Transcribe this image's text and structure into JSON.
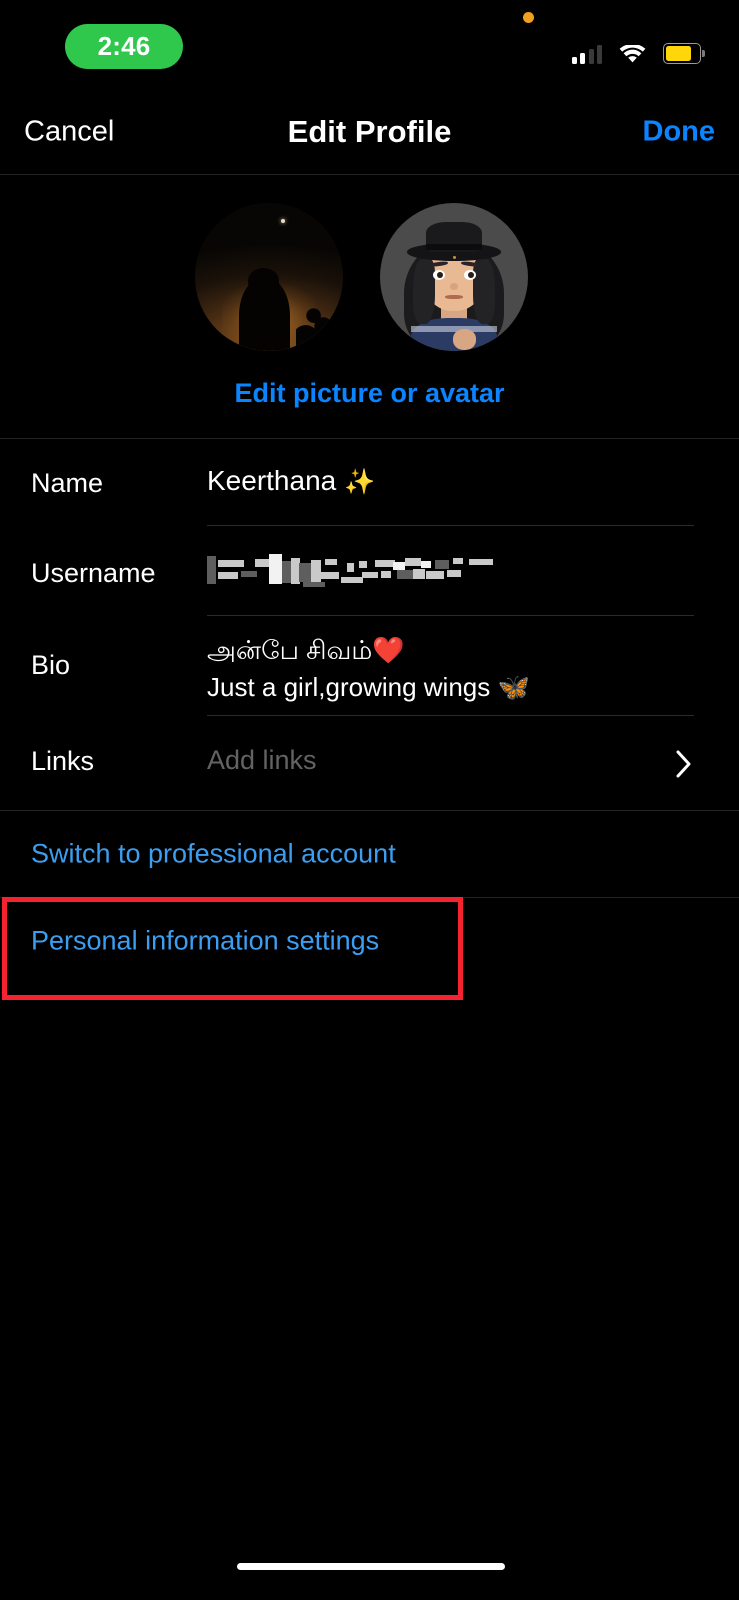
{
  "status_bar": {
    "time": "2:46",
    "time_pill_color": "#30c74d",
    "privacy_dot_color": "#f0a020",
    "battery_color": "#ffd60a",
    "signal_icon": "cellular-bars-icon",
    "wifi_icon": "wifi-icon",
    "battery_icon": "battery-icon"
  },
  "nav": {
    "cancel_label": "Cancel",
    "title": "Edit Profile",
    "done_label": "Done",
    "done_color": "#0a84ff"
  },
  "avatar_section": {
    "profile_picture_alt": "profile-photo-sunset-silhouette",
    "avatar_alt": "memoji-avatar-woman-black-hat",
    "edit_link_label": "Edit picture or avatar",
    "edit_link_color": "#0a84ff"
  },
  "fields": {
    "name": {
      "label": "Name",
      "value": "Keerthana",
      "emoji": "✨"
    },
    "username": {
      "label": "Username",
      "value": "",
      "redacted": true
    },
    "bio": {
      "label": "Bio",
      "line1": "அன்பே சிவம்",
      "line1_emoji": "❤️",
      "line2": "Just a girl,growing wings",
      "line2_emoji": "🦋"
    },
    "links": {
      "label": "Links",
      "placeholder": "Add links",
      "chevron_icon": "chevron-right-icon"
    }
  },
  "actions": [
    {
      "label": "Switch to professional account",
      "color": "#3c9ef0"
    },
    {
      "label": "Personal information settings",
      "color": "#3c9ef0"
    }
  ],
  "annotation": {
    "target": "Personal information settings",
    "box_color": "#f5232f"
  }
}
